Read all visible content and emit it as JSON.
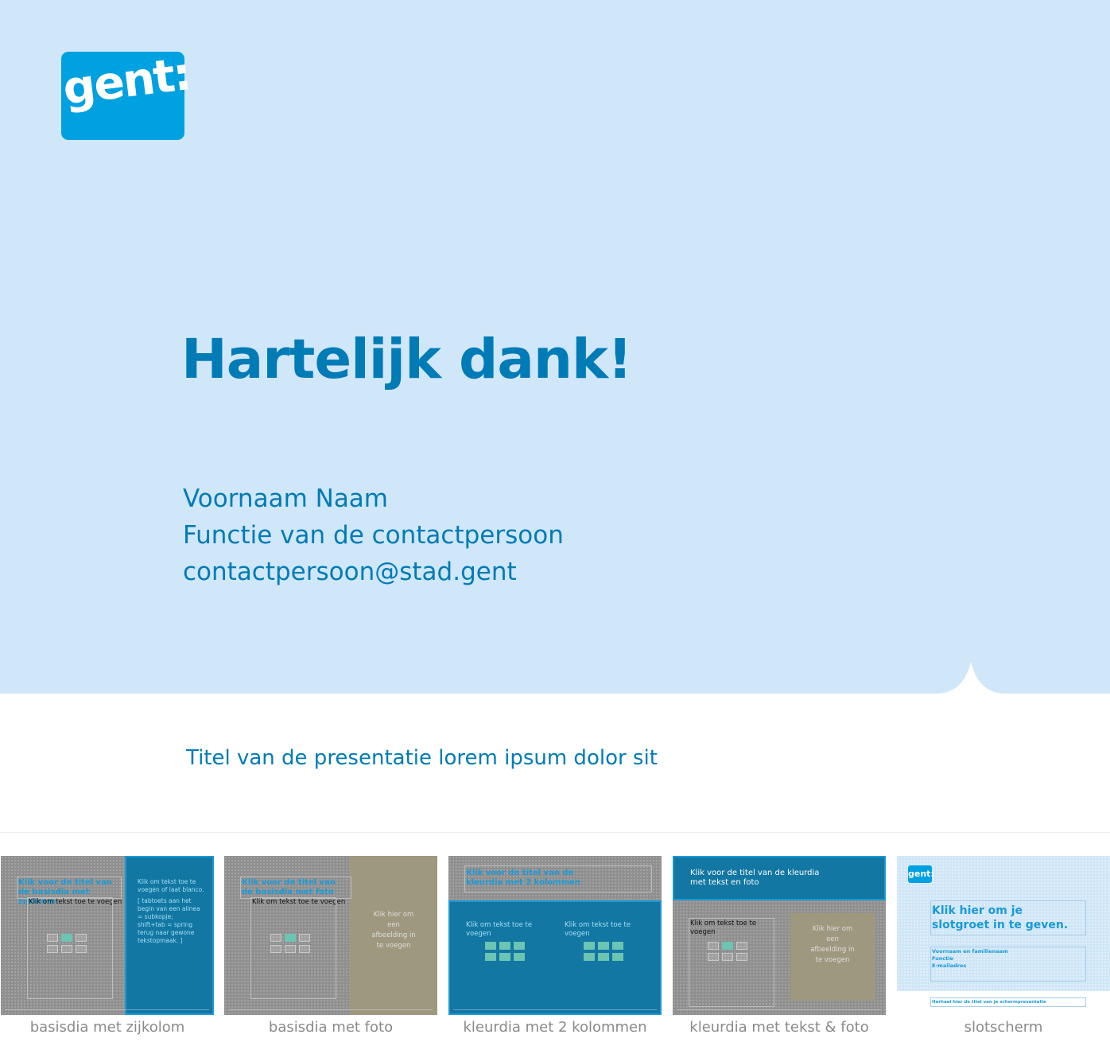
{
  "slide": {
    "logo_text": "gent:",
    "headline": "Hartelijk dank!",
    "contact": {
      "name": "Voornaam Naam",
      "function": "Functie van de contactpersoon",
      "email": "contactpersoon@stad.gent"
    },
    "presentation_title": "Titel van de presentatie lorem ipsum dolor sit"
  },
  "colors": {
    "background_light": "#d0e7fa",
    "brand_blue": "#00a1e0",
    "text_blue": "#007bb6"
  },
  "layouts": [
    {
      "label": "basisdia met zijkolom",
      "title": "Klik voor de titel van de basisdia met zijkolom",
      "body": "Klik om tekst toe te voegen",
      "side": "Klik om tekst toe te voegen of laat blanco.",
      "side2": "[ tabtoets aan het begin van een alinea = subkopje;",
      "side3": "shift+tab = spring terug naar gewone tekstopmaak. ]"
    },
    {
      "label": "basisdia met foto",
      "title": "Klik voor de titel van de basisdia met foto",
      "body": "Klik om tekst toe te voegen",
      "photo": "Klik hier om een afbeelding in te voegen"
    },
    {
      "label": "kleurdia met 2 kolommen",
      "title": "Klik voor de titel van de kleurdia met 2 kolommen",
      "col1": "Klik om tekst toe te voegen",
      "col2": "Klik om tekst toe te voegen"
    },
    {
      "label": "kleurdia met tekst & foto",
      "title": "Klik voor de titel van de kleurdia met tekst en foto",
      "body": "Klik om tekst toe te voegen",
      "photo": "Klik hier om een afbeelding in te voegen"
    },
    {
      "label": "slotscherm",
      "logo": "gent:",
      "title": "Klik hier om je slotgroet in te geven.",
      "line1": "Voornaam en familienaam",
      "line2": "Functie",
      "line3": "E-mailadres",
      "footer": "Herhaal hier de titel van je schermpresentatie"
    }
  ]
}
